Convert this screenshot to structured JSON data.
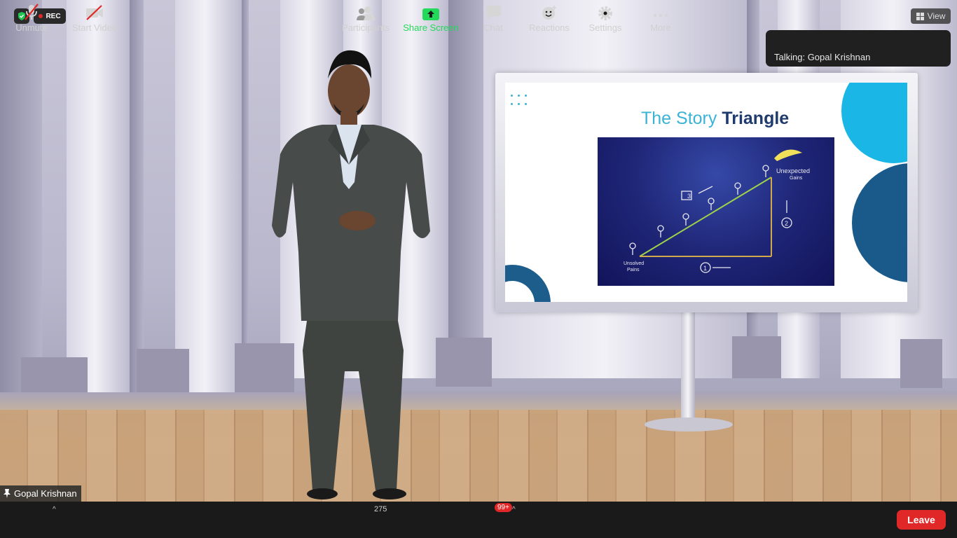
{
  "status": {
    "rec_label": "REC"
  },
  "view_button": {
    "label": "View"
  },
  "active_speaker": {
    "text": "Talking: Gopal Krishnan"
  },
  "video_name_tag": {
    "name": "Gopal Krishnan"
  },
  "slide": {
    "title_part1": "The Story",
    "title_part2": "Triangle",
    "labels": {
      "unexpected_gains": "Unexpected",
      "unexpected_gains_2": "Gains",
      "unsolved_pains": "Unsolved",
      "unsolved_pains_2": "Pains",
      "step1": "1",
      "step2": "2",
      "step3": "3"
    }
  },
  "toolbar": {
    "unmute_label": "Unmute",
    "start_video_label": "Start Video",
    "participants_label": "Participants",
    "participants_count": "275",
    "share_screen_label": "Share Screen",
    "chat_label": "Chat",
    "chat_badge": "99+",
    "reactions_label": "Reactions",
    "settings_label": "Settings",
    "more_label": "More",
    "leave_label": "Leave"
  },
  "colors": {
    "leave": "#e02828",
    "share_green": "#23d959",
    "toolbar_bg": "#1a1a1a"
  }
}
